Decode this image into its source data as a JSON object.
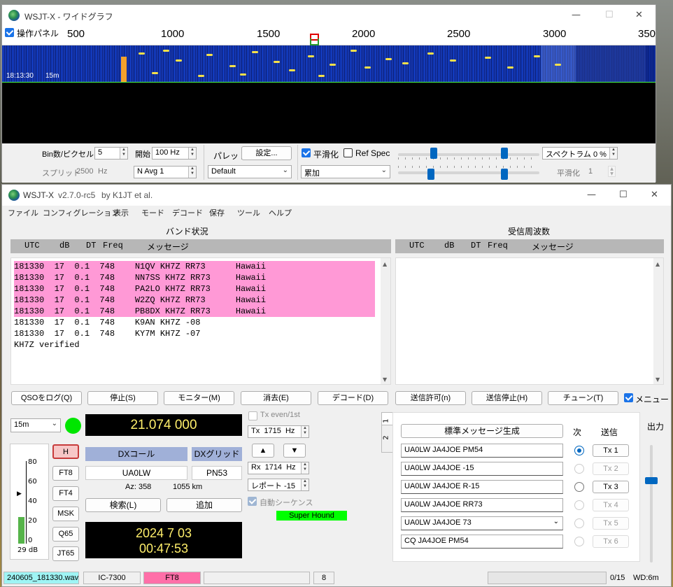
{
  "wide_graph": {
    "title": "WSJT-X - ワイドグラフ",
    "control_panel_label": "操作パネル",
    "scale_ticks": [
      "500",
      "1000",
      "1500",
      "2000",
      "2500",
      "3000",
      "350"
    ],
    "timestamp": "18:13:30",
    "band": "15m",
    "bins_label": "Bin数/ピクセル",
    "bins_value": "5",
    "start_label": "開始",
    "start_value": "100 Hz",
    "split_label": "スプリット",
    "split_value": "2500",
    "split_unit": "Hz",
    "navg_value": "N Avg 1",
    "palette_label": "パレット",
    "palette_settings_btn": "設定...",
    "palette_value": "Default",
    "smooth_label": "平滑化",
    "refspec_label": "Ref Spec",
    "accumulate_value": "累加",
    "spectrum_value": "スペクトラム 0 %",
    "smooth_value_label": "平滑化",
    "smooth_value": "1"
  },
  "main": {
    "title": "WSJT-X",
    "version": "v2.7.0-rc5",
    "by": "by K1JT et al.",
    "menu": [
      "ファイル",
      "コンフィグレーション",
      "表示",
      "モード",
      "デコード",
      "保存",
      "ツール",
      "ヘルプ"
    ],
    "band_activity_title": "バンド状況",
    "rx_freq_title": "受信周波数",
    "columns": {
      "utc": "UTC",
      "db": "dB",
      "dt": "DT",
      "freq": "Freq",
      "msg": "メッセージ"
    },
    "decodes": [
      {
        "text": "181330  17  0.1  748    N1QV KH7Z RR73      Hawaii",
        "hl": true
      },
      {
        "text": "181330  17  0.1  748    NN7SS KH7Z RR73     Hawaii",
        "hl": true
      },
      {
        "text": "181330  17  0.1  748    PA2LO KH7Z RR73     Hawaii",
        "hl": true
      },
      {
        "text": "181330  17  0.1  748    W2ZQ KH7Z RR73      Hawaii",
        "hl": true
      },
      {
        "text": "181330  17  0.1  748    PB8DX KH7Z RR73     Hawaii",
        "hl": true
      },
      {
        "text": "181330  17  0.1  748    K9AN KH7Z -08",
        "hl": false
      },
      {
        "text": "181330  17  0.1  748    KY7M KH7Z -07",
        "hl": false
      },
      {
        "text": "KH7Z verified",
        "hl": false
      }
    ],
    "buttons": {
      "log_qso": "QSOをログ(Q)",
      "stop": "停止(S)",
      "monitor": "モニター(M)",
      "erase": "消去(E)",
      "decode": "デコード(D)",
      "enable_tx": "送信許可(n)",
      "halt_tx": "送信停止(H)",
      "tune": "チューン(T)",
      "menus": "メニュー"
    },
    "band_select": "15m",
    "dial_freq": "21.074 000",
    "tx_even": "Tx even/1st",
    "tx_freq_label": "Tx",
    "tx_freq": "1715",
    "rx_freq_label": "Rx",
    "rx_freq": "1714",
    "freq_unit": "Hz",
    "report": "レポート -15",
    "auto_seq": "自動シーケンス",
    "super_hound": "Super Hound",
    "modes": [
      "H",
      "FT8",
      "FT4",
      "MSK",
      "Q65",
      "JT65"
    ],
    "meter_ticks": [
      "80",
      "60",
      "40",
      "20",
      "0"
    ],
    "meter_value": "29 dB",
    "dx_call_label": "DXコール",
    "dx_grid_label": "DXグリッド",
    "dx_call": "UA0LW",
    "dx_grid": "PN53",
    "az": "Az: 358",
    "dist": "1055 km",
    "lookup": "検索(L)",
    "add": "追加",
    "date": "2024 7 03",
    "time": "00:47:53",
    "tab1": "1",
    "tab2": "2",
    "gen_std": "標準メッセージ生成",
    "next_label": "次",
    "send_label": "送信",
    "tx_msgs": [
      "UA0LW JA4JOE PM54",
      "UA0LW JA4JOE -15",
      "UA0LW JA4JOE R-15",
      "UA0LW JA4JOE RR73",
      "UA0LW JA4JOE 73",
      "CQ JA4JOE PM54"
    ],
    "tx_btns": [
      "Tx 1",
      "Tx 2",
      "Tx 3",
      "Tx 4",
      "Tx 5",
      "Tx 6"
    ],
    "output_label": "出力",
    "status": {
      "file": "240605_181330.wav",
      "rig": "IC-7300",
      "mode": "FT8",
      "num": "8",
      "count": "0/15",
      "wd": "WD:6m"
    }
  }
}
